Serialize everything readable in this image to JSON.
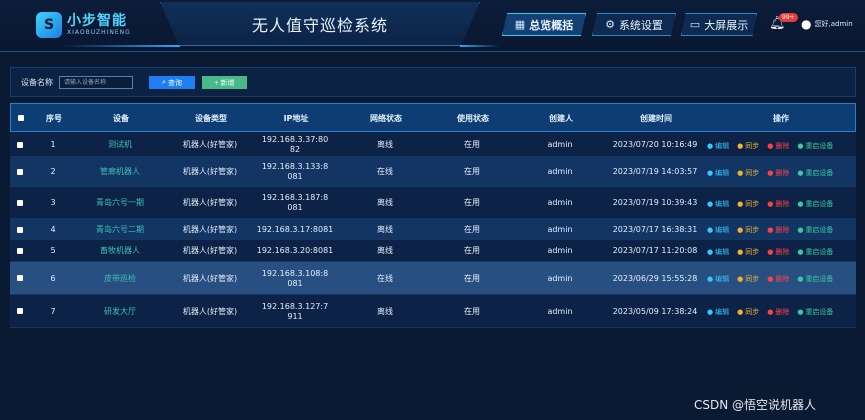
{
  "header": {
    "logo_mark": "S",
    "logo_name": "小步智能",
    "logo_sub": "XIAOBUZHINENG",
    "title": "无人值守巡检系统",
    "nav": [
      {
        "label": "总览概括",
        "icon": "grid-icon",
        "glyph": "▦"
      },
      {
        "label": "系统设置",
        "icon": "gear-icon",
        "glyph": "⚙"
      },
      {
        "label": "大屏展示",
        "icon": "monitor-icon",
        "glyph": "▭"
      }
    ],
    "notification_count": "99+",
    "user_name": "您好,admin"
  },
  "search": {
    "label": "设备名称",
    "placeholder": "请输入设备名称",
    "query_label": "查询",
    "add_label": "+ 新增"
  },
  "table": {
    "columns": [
      "序号",
      "设备",
      "设备类型",
      "IP地址",
      "网络状态",
      "使用状态",
      "创建人",
      "创建时间",
      "操作"
    ],
    "rows": [
      {
        "no": "1",
        "device": "测试机",
        "type": "机器人(好管家)",
        "ip": "192.168.3.37:8082",
        "net": "离线",
        "use": "在用",
        "creator": "admin",
        "time": "2023/07/20 10:16:49"
      },
      {
        "no": "2",
        "device": "管廊机器人",
        "type": "机器人(好管家)",
        "ip": "192.168.3.133:8081",
        "net": "在线",
        "use": "在用",
        "creator": "admin",
        "time": "2023/07/19 14:03:57"
      },
      {
        "no": "3",
        "device": "青岛六号一期",
        "type": "机器人(好管家)",
        "ip": "192.168.3.187:8081",
        "net": "离线",
        "use": "在用",
        "creator": "admin",
        "time": "2023/07/19 10:39:43"
      },
      {
        "no": "4",
        "device": "青岛六号二期",
        "type": "机器人(好管家)",
        "ip": "192.168.3.17:8081",
        "net": "离线",
        "use": "在用",
        "creator": "admin",
        "time": "2023/07/17 16:38:31"
      },
      {
        "no": "5",
        "device": "畜牧机器人",
        "type": "机器人(好管家)",
        "ip": "192.168.3.20:8081",
        "net": "离线",
        "use": "在用",
        "creator": "admin",
        "time": "2023/07/17 11:20:08"
      },
      {
        "no": "6",
        "device": "皮带巡检",
        "type": "机器人(好管家)",
        "ip": "192.168.3.108:8081",
        "net": "在线",
        "use": "在用",
        "creator": "admin",
        "time": "2023/06/29 15:55:28"
      },
      {
        "no": "7",
        "device": "研发大厅",
        "type": "机器人(好管家)",
        "ip": "192.168.3.127:7911",
        "net": "离线",
        "use": "在用",
        "creator": "admin",
        "time": "2023/05/09 17:38:24"
      }
    ],
    "actions": {
      "edit": "编辑",
      "sync": "同步",
      "delete": "删除",
      "restart": "重启设备"
    }
  },
  "watermark": "CSDN @悟空说机器人"
}
